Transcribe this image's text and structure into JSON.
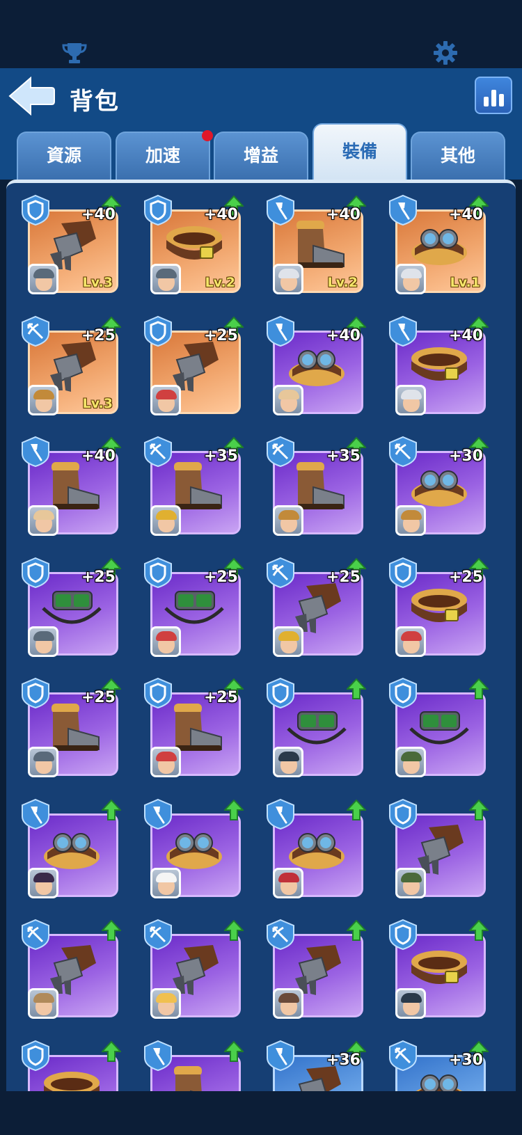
{
  "header": {
    "title": "背包"
  },
  "tabs": [
    {
      "label": "資源",
      "active": false,
      "dot": false
    },
    {
      "label": "加速",
      "active": false,
      "dot": true
    },
    {
      "label": "增益",
      "active": false,
      "dot": false
    },
    {
      "label": "裝備",
      "active": true,
      "dot": false
    },
    {
      "label": "其他",
      "active": false,
      "dot": false
    }
  ],
  "colors": {
    "header": "#124a86",
    "panel": "#163f74",
    "orange_card": "#e58a4c",
    "purple_card": "#8a4ad9",
    "blue_card": "#4a86d6"
  },
  "items": [
    {
      "type": "shield",
      "rarity": "orange",
      "icon": "gauntlet-icon",
      "bonus": "+40",
      "level": "Lv.3",
      "hero": "hero-dwarf-helmet"
    },
    {
      "type": "shield",
      "rarity": "orange",
      "icon": "belt-icon",
      "bonus": "+40",
      "level": "Lv.2",
      "hero": "hero-dwarf-helmet"
    },
    {
      "type": "shovel",
      "rarity": "orange",
      "icon": "boot-icon",
      "bonus": "+40",
      "level": "Lv.2",
      "hero": "hero-white-hair"
    },
    {
      "type": "shovel",
      "rarity": "orange",
      "icon": "goggles-icon",
      "bonus": "+40",
      "level": "Lv.1",
      "hero": "hero-white-hair"
    },
    {
      "type": "crossbow",
      "rarity": "orange",
      "icon": "gauntlet-icon",
      "bonus": "+25",
      "level": "Lv.3",
      "hero": "hero-goggles-man"
    },
    {
      "type": "shield",
      "rarity": "orange",
      "icon": "gauntlet-icon",
      "bonus": "+25",
      "level": "",
      "hero": "hero-red-cap"
    },
    {
      "type": "shovel",
      "rarity": "purple",
      "icon": "goggles-icon",
      "bonus": "+40",
      "level": "",
      "hero": "hero-cow"
    },
    {
      "type": "shovel",
      "rarity": "purple",
      "icon": "belt-icon",
      "bonus": "+40",
      "level": "",
      "hero": "hero-white-hair"
    },
    {
      "type": "shovel",
      "rarity": "purple",
      "icon": "boot-icon",
      "bonus": "+40",
      "level": "",
      "hero": "hero-cow"
    },
    {
      "type": "crossbow",
      "rarity": "purple",
      "icon": "boot-icon",
      "bonus": "+35",
      "level": "",
      "hero": "hero-miner"
    },
    {
      "type": "crossbow",
      "rarity": "purple",
      "icon": "boot-icon",
      "bonus": "+35",
      "level": "",
      "hero": "hero-goggles-man"
    },
    {
      "type": "crossbow",
      "rarity": "purple",
      "icon": "goggles-icon",
      "bonus": "+30",
      "level": "",
      "hero": "hero-goggles-man"
    },
    {
      "type": "shield",
      "rarity": "purple",
      "icon": "goggles-green-icon",
      "bonus": "+25",
      "level": "",
      "hero": "hero-dwarf-helmet"
    },
    {
      "type": "shield",
      "rarity": "purple",
      "icon": "goggles-green-icon",
      "bonus": "+25",
      "level": "",
      "hero": "hero-red-cap"
    },
    {
      "type": "crossbow",
      "rarity": "purple",
      "icon": "gauntlet-icon",
      "bonus": "+25",
      "level": "",
      "hero": "hero-miner"
    },
    {
      "type": "shield",
      "rarity": "purple",
      "icon": "belt-icon",
      "bonus": "+25",
      "level": "",
      "hero": "hero-red-cap"
    },
    {
      "type": "shield",
      "rarity": "purple",
      "icon": "boot-icon",
      "bonus": "+25",
      "level": "",
      "hero": "hero-dwarf-helmet"
    },
    {
      "type": "shield",
      "rarity": "purple",
      "icon": "boot-icon",
      "bonus": "+25",
      "level": "",
      "hero": "hero-red-cap"
    },
    {
      "type": "shield",
      "rarity": "purple",
      "icon": "goggles-green-icon",
      "bonus": "",
      "level": "",
      "hero": "hero-gasmask"
    },
    {
      "type": "shield",
      "rarity": "purple",
      "icon": "goggles-green-icon",
      "bonus": "",
      "level": "",
      "hero": "hero-soldier"
    },
    {
      "type": "shovel",
      "rarity": "purple",
      "icon": "goggles-icon",
      "bonus": "",
      "level": "",
      "hero": "hero-dark-hair"
    },
    {
      "type": "shovel",
      "rarity": "purple",
      "icon": "goggles-icon",
      "bonus": "",
      "level": "",
      "hero": "hero-chef"
    },
    {
      "type": "shovel",
      "rarity": "purple",
      "icon": "goggles-icon",
      "bonus": "",
      "level": "",
      "hero": "hero-bandana"
    },
    {
      "type": "shield",
      "rarity": "purple",
      "icon": "gauntlet-icon",
      "bonus": "",
      "level": "",
      "hero": "hero-soldier"
    },
    {
      "type": "crossbow",
      "rarity": "purple",
      "icon": "gauntlet-icon",
      "bonus": "",
      "level": "",
      "hero": "hero-cowboy"
    },
    {
      "type": "crossbow",
      "rarity": "purple",
      "icon": "gauntlet-icon",
      "bonus": "",
      "level": "",
      "hero": "hero-blonde"
    },
    {
      "type": "crossbow",
      "rarity": "purple",
      "icon": "gauntlet-icon",
      "bonus": "",
      "level": "",
      "hero": "hero-girl"
    },
    {
      "type": "shield",
      "rarity": "purple",
      "icon": "belt-icon",
      "bonus": "",
      "level": "",
      "hero": "hero-gasmask"
    },
    {
      "type": "shield",
      "rarity": "purple",
      "icon": "belt-icon",
      "bonus": "",
      "level": "",
      "hero": ""
    },
    {
      "type": "shovel",
      "rarity": "purple",
      "icon": "boot-icon",
      "bonus": "",
      "level": "",
      "hero": ""
    },
    {
      "type": "shovel",
      "rarity": "blue",
      "icon": "gauntlet-icon",
      "bonus": "+36",
      "level": "",
      "hero": ""
    },
    {
      "type": "crossbow",
      "rarity": "blue",
      "icon": "goggles-icon",
      "bonus": "+30",
      "level": "",
      "hero": ""
    }
  ]
}
